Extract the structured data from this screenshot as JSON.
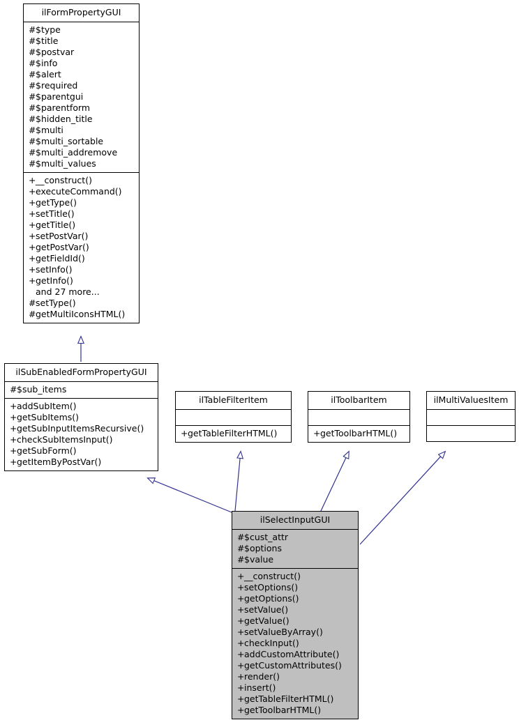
{
  "diagram": {
    "type": "uml-class-inheritance",
    "line_color": "#303090",
    "highlight_color": "#bfbfbf",
    "border_color": "#000000",
    "background_color": "#ffffff"
  },
  "classes": [
    {
      "id": "ilFormPropertyGUI",
      "name": "ilFormPropertyGUI",
      "highlighted": false,
      "attributes": [
        {
          "vis": "#",
          "text": "$type"
        },
        {
          "vis": "#",
          "text": "$title"
        },
        {
          "vis": "#",
          "text": "$postvar"
        },
        {
          "vis": "#",
          "text": "$info"
        },
        {
          "vis": "#",
          "text": "$alert"
        },
        {
          "vis": "#",
          "text": "$required"
        },
        {
          "vis": "#",
          "text": "$parentgui"
        },
        {
          "vis": "#",
          "text": "$parentform"
        },
        {
          "vis": "#",
          "text": "$hidden_title"
        },
        {
          "vis": "#",
          "text": "$multi"
        },
        {
          "vis": "#",
          "text": "$multi_sortable"
        },
        {
          "vis": "#",
          "text": "$multi_addremove"
        },
        {
          "vis": "#",
          "text": "$multi_values"
        }
      ],
      "methods": [
        {
          "vis": "+",
          "text": "__construct()"
        },
        {
          "vis": "+",
          "text": "executeCommand()"
        },
        {
          "vis": "+",
          "text": "getType()"
        },
        {
          "vis": "+",
          "text": "setTitle()"
        },
        {
          "vis": "+",
          "text": "getTitle()"
        },
        {
          "vis": "+",
          "text": "setPostVar()"
        },
        {
          "vis": "+",
          "text": "getPostVar()"
        },
        {
          "vis": "+",
          "text": "getFieldId()"
        },
        {
          "vis": "+",
          "text": "setInfo()"
        },
        {
          "vis": "+",
          "text": "getInfo()"
        },
        {
          "vis": "",
          "text": "and 27 more..."
        },
        {
          "vis": "#",
          "text": "setType()"
        },
        {
          "vis": "#",
          "text": "getMultiIconsHTML()"
        }
      ]
    },
    {
      "id": "ilSubEnabledFormPropertyGUI",
      "name": "ilSubEnabledFormPropertyGUI",
      "highlighted": false,
      "attributes": [
        {
          "vis": "#",
          "text": "$sub_items"
        }
      ],
      "methods": [
        {
          "vis": "+",
          "text": "addSubItem()"
        },
        {
          "vis": "+",
          "text": "getSubItems()"
        },
        {
          "vis": "+",
          "text": "getSubInputItemsRecursive()"
        },
        {
          "vis": "+",
          "text": "checkSubItemsInput()"
        },
        {
          "vis": "+",
          "text": "getSubForm()"
        },
        {
          "vis": "+",
          "text": "getItemByPostVar()"
        }
      ]
    },
    {
      "id": "ilTableFilterItem",
      "name": "ilTableFilterItem",
      "highlighted": false,
      "attributes": [],
      "methods": [
        {
          "vis": "+",
          "text": "getTableFilterHTML()"
        }
      ]
    },
    {
      "id": "ilToolbarItem",
      "name": "ilToolbarItem",
      "highlighted": false,
      "attributes": [],
      "methods": [
        {
          "vis": "+",
          "text": "getToolbarHTML()"
        }
      ]
    },
    {
      "id": "ilMultiValuesItem",
      "name": "ilMultiValuesItem",
      "highlighted": false,
      "attributes": [],
      "methods": []
    },
    {
      "id": "ilSelectInputGUI",
      "name": "ilSelectInputGUI",
      "highlighted": true,
      "attributes": [
        {
          "vis": "#",
          "text": "$cust_attr"
        },
        {
          "vis": "#",
          "text": "$options"
        },
        {
          "vis": "#",
          "text": "$value"
        }
      ],
      "methods": [
        {
          "vis": "+",
          "text": "__construct()"
        },
        {
          "vis": "+",
          "text": "setOptions()"
        },
        {
          "vis": "+",
          "text": "getOptions()"
        },
        {
          "vis": "+",
          "text": "setValue()"
        },
        {
          "vis": "+",
          "text": "getValue()"
        },
        {
          "vis": "+",
          "text": "setValueByArray()"
        },
        {
          "vis": "+",
          "text": "checkInput()"
        },
        {
          "vis": "+",
          "text": "addCustomAttribute()"
        },
        {
          "vis": "+",
          "text": "getCustomAttributes()"
        },
        {
          "vis": "+",
          "text": "render()"
        },
        {
          "vis": "+",
          "text": "insert()"
        },
        {
          "vis": "+",
          "text": "getTableFilterHTML()"
        },
        {
          "vis": "+",
          "text": "getToolbarHTML()"
        }
      ]
    }
  ],
  "edges": [
    {
      "from": "ilSubEnabledFormPropertyGUI",
      "to": "ilFormPropertyGUI",
      "kind": "inheritance"
    },
    {
      "from": "ilSelectInputGUI",
      "to": "ilSubEnabledFormPropertyGUI",
      "kind": "inheritance"
    },
    {
      "from": "ilSelectInputGUI",
      "to": "ilTableFilterItem",
      "kind": "inheritance"
    },
    {
      "from": "ilSelectInputGUI",
      "to": "ilToolbarItem",
      "kind": "inheritance"
    },
    {
      "from": "ilSelectInputGUI",
      "to": "ilMultiValuesItem",
      "kind": "inheritance"
    }
  ]
}
